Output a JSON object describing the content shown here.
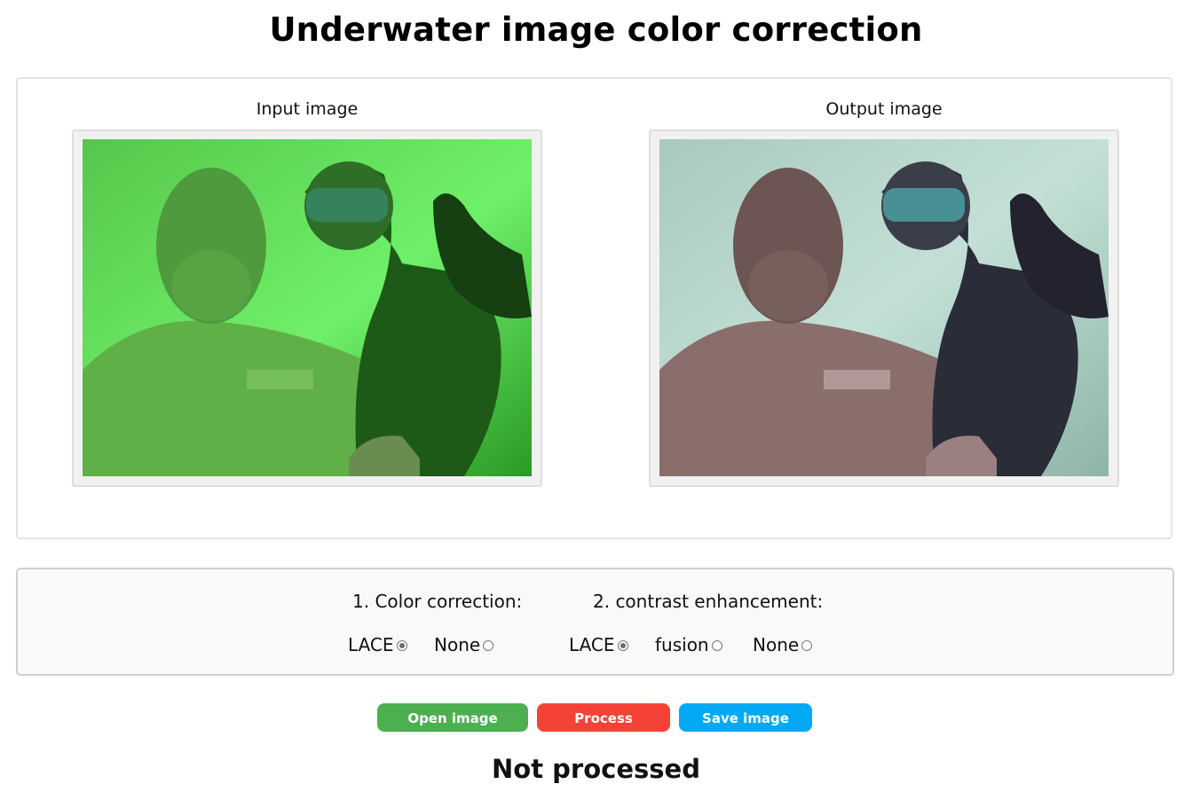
{
  "page": {
    "title": "Underwater image color correction"
  },
  "images": {
    "input_label": "Input image",
    "output_label": "Output image",
    "input_tint": "#3fd63a",
    "output_tint": "#bcd6cc"
  },
  "controls": {
    "color_correction": {
      "label": "1. Color correction:",
      "options": [
        {
          "label": "LACE",
          "selected": true
        },
        {
          "label": "None",
          "selected": false
        }
      ]
    },
    "contrast_enhancement": {
      "label": "2. contrast enhancement:",
      "options": [
        {
          "label": "LACE",
          "selected": true
        },
        {
          "label": "fusion",
          "selected": false
        },
        {
          "label": "None",
          "selected": false
        }
      ]
    }
  },
  "buttons": {
    "open": {
      "label": "Open image",
      "color": "#4caf50"
    },
    "process": {
      "label": "Process",
      "color": "#f44336"
    },
    "save": {
      "label": "Save image",
      "color": "#03a9f4"
    }
  },
  "status": "Not processed"
}
